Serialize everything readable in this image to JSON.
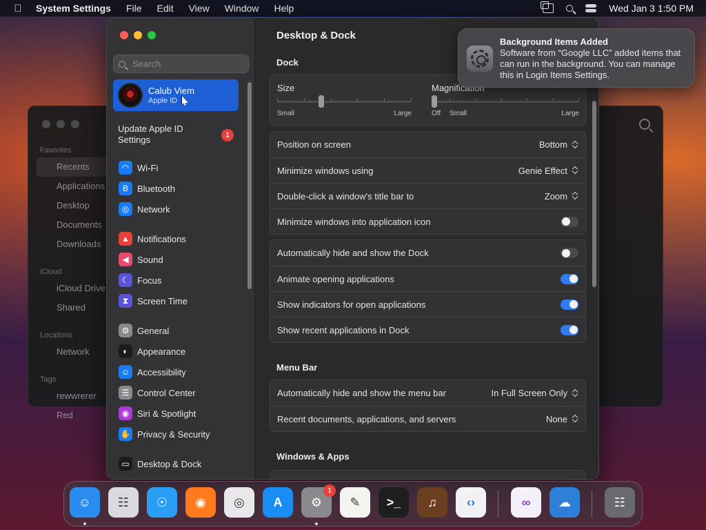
{
  "menubar": {
    "app_name": "System Settings",
    "items": [
      "File",
      "Edit",
      "View",
      "Window",
      "Help"
    ],
    "datetime": "Wed Jan 3  1:50 PM"
  },
  "finder": {
    "sections": [
      {
        "header": "Favorites",
        "items": [
          "Recents",
          "Applications",
          "Desktop",
          "Documents",
          "Downloads"
        ]
      },
      {
        "header": "iCloud",
        "items": [
          "iCloud Drive",
          "Shared"
        ]
      },
      {
        "header": "Locations",
        "items": [
          "Network"
        ]
      },
      {
        "header": "Tags",
        "items": [
          "rewwrerer",
          "Red"
        ]
      }
    ]
  },
  "sidebar": {
    "search_placeholder": "Search",
    "account": {
      "name": "Calub Viem",
      "subtitle": "Apple ID"
    },
    "update": {
      "label": "Update Apple ID Settings",
      "badge": "1"
    },
    "groups": [
      [
        {
          "label": "Wi-Fi",
          "icon": "wifi-icon",
          "color": "#1a7cf5"
        },
        {
          "label": "Bluetooth",
          "icon": "bluetooth-icon",
          "color": "#1a7cf5"
        },
        {
          "label": "Network",
          "icon": "globe-icon",
          "color": "#1a7cf5"
        }
      ],
      [
        {
          "label": "Notifications",
          "icon": "bell-icon",
          "color": "#e8403b"
        },
        {
          "label": "Sound",
          "icon": "speaker-icon",
          "color": "#e84a6b"
        },
        {
          "label": "Focus",
          "icon": "moon-icon",
          "color": "#5a54d6"
        },
        {
          "label": "Screen Time",
          "icon": "hourglass-icon",
          "color": "#5a54d6"
        }
      ],
      [
        {
          "label": "General",
          "icon": "gear-icon",
          "color": "#8a8a8e"
        },
        {
          "label": "Appearance",
          "icon": "appearance-icon",
          "color": "#1c1c1e"
        },
        {
          "label": "Accessibility",
          "icon": "accessibility-icon",
          "color": "#1a7cf5"
        },
        {
          "label": "Control Center",
          "icon": "control-center-icon",
          "color": "#8a8a8e"
        },
        {
          "label": "Siri & Spotlight",
          "icon": "siri-icon",
          "color": "#b03ad8"
        },
        {
          "label": "Privacy & Security",
          "icon": "hand-icon",
          "color": "#1a7cf5"
        }
      ],
      [
        {
          "label": "Desktop & Dock",
          "icon": "desktop-dock-icon",
          "color": "#1c1c1e"
        }
      ]
    ]
  },
  "main": {
    "title": "Desktop & Dock",
    "dock_section": "Dock",
    "size": {
      "label": "Size",
      "min": "Small",
      "max": "Large",
      "value_fraction": 0.33
    },
    "magnification": {
      "label": "Magnification",
      "off": "Off",
      "min": "Small",
      "max": "Large",
      "value_fraction": 0.0
    },
    "dock_rows": [
      {
        "label": "Position on screen",
        "value": "Bottom"
      },
      {
        "label": "Minimize windows using",
        "value": "Genie Effect"
      },
      {
        "label": "Double-click a window's title bar to",
        "value": "Zoom"
      },
      {
        "label": "Minimize windows into application icon",
        "toggle": false
      }
    ],
    "dock_toggles": [
      {
        "label": "Automatically hide and show the Dock",
        "toggle": false
      },
      {
        "label": "Animate opening applications",
        "toggle": true
      },
      {
        "label": "Show indicators for open applications",
        "toggle": true
      },
      {
        "label": "Show recent applications in Dock",
        "toggle": true
      }
    ],
    "menubar_section": "Menu Bar",
    "menubar_rows": [
      {
        "label": "Automatically hide and show the menu bar",
        "value": "In Full Screen Only"
      },
      {
        "label": "Recent documents, applications, and servers",
        "value": "None"
      }
    ],
    "windows_section": "Windows & Apps"
  },
  "notification": {
    "title": "Background Items Added",
    "body": "Software from “Google LLC” added items that can run in the background. You can manage this in Login Items Settings."
  },
  "dock": {
    "apps": [
      {
        "name": "finder",
        "color": "#2b8cf0",
        "glyph": "☺",
        "running": true
      },
      {
        "name": "launchpad",
        "color": "#d9d9de",
        "glyph": "☷",
        "running": false
      },
      {
        "name": "safari",
        "color": "#2a9df4",
        "glyph": "☉",
        "running": false
      },
      {
        "name": "firefox",
        "color": "#ff7a1a",
        "glyph": "◉",
        "running": false
      },
      {
        "name": "chrome",
        "color": "#e8e8ea",
        "glyph": "◎",
        "running": false
      },
      {
        "name": "app-store",
        "color": "#1a8df5",
        "glyph": "A",
        "running": false
      },
      {
        "name": "system-settings",
        "color": "#8a8a8e",
        "glyph": "⚙",
        "running": true,
        "badge": "1"
      },
      {
        "name": "textedit",
        "color": "#f4f4f0",
        "glyph": "✎",
        "running": false
      },
      {
        "name": "terminal",
        "color": "#1e1e1e",
        "glyph": ">_",
        "running": false
      },
      {
        "name": "garageband",
        "color": "#6a4020",
        "glyph": "♫",
        "running": false
      },
      {
        "name": "vscode",
        "color": "#f2f2f4",
        "glyph": "‹›",
        "running": false
      },
      {
        "name": "visual-studio",
        "color": "#f4f0fa",
        "glyph": "∞",
        "running": false
      },
      {
        "name": "weather",
        "color": "#2e7fd8",
        "glyph": "☁",
        "running": false
      },
      {
        "name": "trash",
        "color": "#6a6a6e",
        "glyph": "☷",
        "running": false
      }
    ]
  }
}
